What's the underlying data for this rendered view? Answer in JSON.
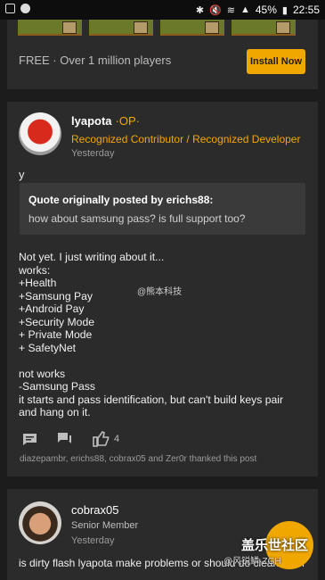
{
  "status_bar": {
    "battery": "45%",
    "time": "22:55",
    "icons": [
      "square-icon",
      "circle-icon",
      "bluetooth-icon",
      "mute-icon",
      "wifi-icon",
      "signal-icon",
      "battery-icon"
    ]
  },
  "ad": {
    "text": "FREE · Over 1 million players",
    "button": "Install Now"
  },
  "post": {
    "username": "lyapota",
    "op_badge": "·OP·",
    "title": "Recognized Contributor / Recognized Developer",
    "date": "Yesterday",
    "lead": "y",
    "quote": {
      "header": "Quote originally posted by erichs88:",
      "text": "how about samsung pass? is full support too?"
    },
    "lines": [
      "Not yet. I just writing about it...",
      "works:",
      "+Health",
      "+Samsung Pay",
      "+Android Pay",
      "+Security Mode",
      "+ Private Mode",
      "+ SafetyNet",
      "",
      "not works",
      "-Samsung Pass",
      "it starts and pass identification, but can't build keys pair",
      "and hang on it."
    ],
    "watermark": "@熊本科技",
    "like_count": "4",
    "thanks": "diazepambr, erichs88, cobrax05 and Zer0r thanked this post"
  },
  "post2": {
    "username": "cobrax05",
    "role": "Senior Member",
    "date": "Yesterday",
    "message": "is dirty flash lyapota make problems or should do clean flash"
  },
  "overlay": {
    "mark": "盖乐世社区",
    "sub": "@风锐鳞·ZGH"
  },
  "colors": {
    "accent": "#f0a800",
    "card": "#2b2b2b",
    "background": "#1c1c1c"
  }
}
